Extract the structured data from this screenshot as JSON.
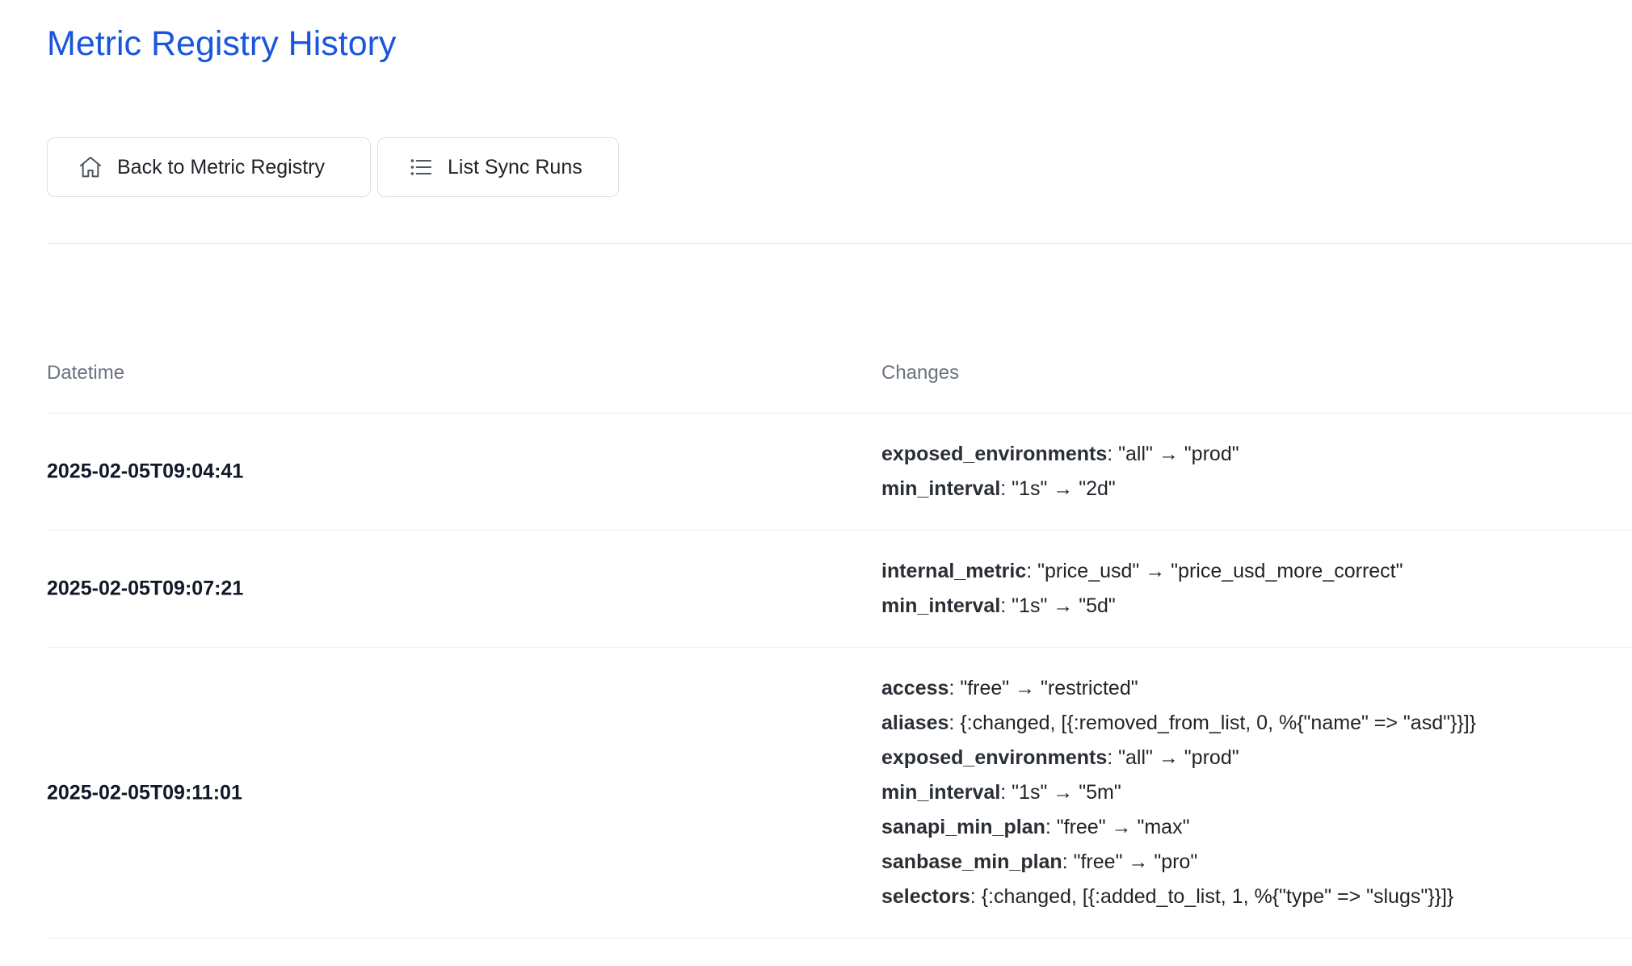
{
  "page": {
    "title": "Metric Registry History"
  },
  "toolbar": {
    "back_label": "Back to Metric Registry",
    "back_icon": "home-icon",
    "sync_label": "List Sync Runs",
    "sync_icon": "list-icon"
  },
  "history": {
    "columns": {
      "datetime": "Datetime",
      "changes": "Changes"
    },
    "rows": [
      {
        "datetime": "2025-02-05T09:04:41",
        "changes": [
          {
            "field": "exposed_environments",
            "value": ": \"all\" → \"prod\""
          },
          {
            "field": "min_interval",
            "value": ": \"1s\" → \"2d\""
          }
        ]
      },
      {
        "datetime": "2025-02-05T09:07:21",
        "changes": [
          {
            "field": "internal_metric",
            "value": ": \"price_usd\" → \"price_usd_more_correct\""
          },
          {
            "field": "min_interval",
            "value": ": \"1s\" → \"5d\""
          }
        ]
      },
      {
        "datetime": "2025-02-05T09:11:01",
        "changes": [
          {
            "field": "access",
            "value": ": \"free\" → \"restricted\""
          },
          {
            "field": "aliases",
            "value": ": {:changed, [{:removed_from_list, 0, %{\"name\" => \"asd\"}}]}"
          },
          {
            "field": "exposed_environments",
            "value": ": \"all\" → \"prod\""
          },
          {
            "field": "min_interval",
            "value": ": \"1s\" → \"5m\""
          },
          {
            "field": "sanapi_min_plan",
            "value": ": \"free\" → \"max\""
          },
          {
            "field": "sanbase_min_plan",
            "value": ": \"free\" → \"pro\""
          },
          {
            "field": "selectors",
            "value": ": {:changed, [{:added_to_list, 1, %{\"type\" => \"slugs\"}}]}"
          }
        ]
      }
    ]
  }
}
